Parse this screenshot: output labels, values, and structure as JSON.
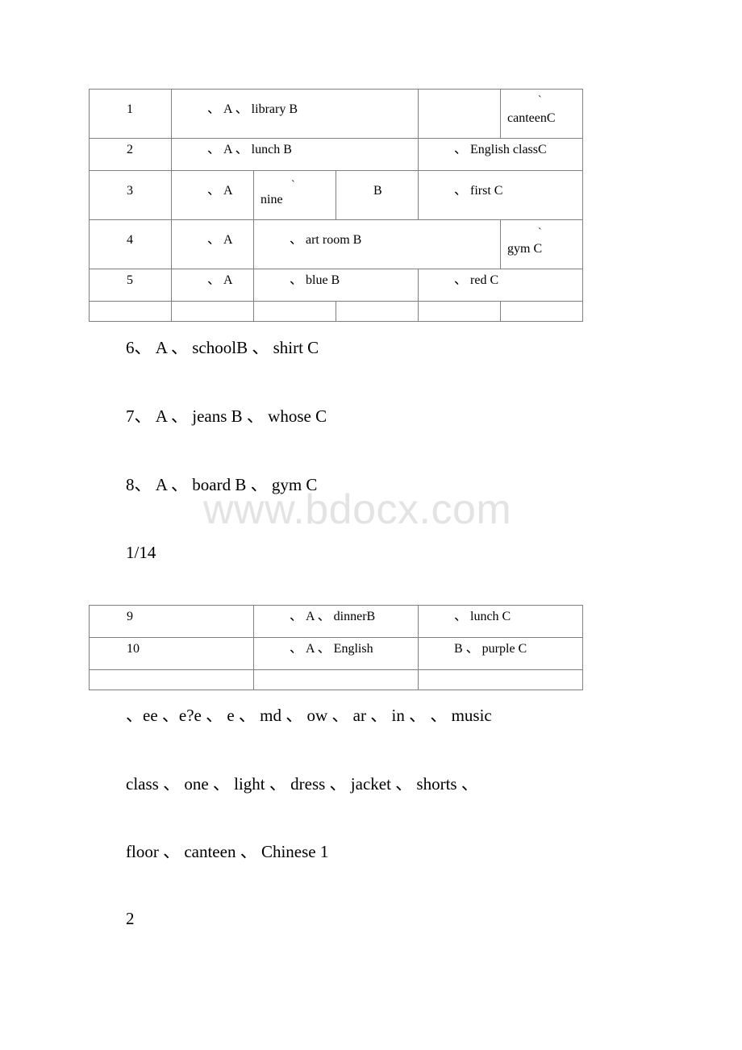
{
  "table1": {
    "rows": [
      {
        "num": "1",
        "a": "、 A 、 library B",
        "b": "",
        "c_mark": "`",
        "c": "canteenC"
      },
      {
        "num": "2",
        "a": "、 A 、 lunch B",
        "b": "、 English classC"
      },
      {
        "num": "3",
        "a": "、 A",
        "b_mark": "`",
        "b": "nine",
        "b2": "B",
        "c": "、 first C"
      },
      {
        "num": "4",
        "a": "、 A",
        "b": "、 art room B",
        "c_mark": "`",
        "c": "gym C"
      },
      {
        "num": "5",
        "a": "、 A",
        "b": "、 blue B",
        "c": "、 red C"
      }
    ]
  },
  "questions": [
    "6、 A 、 schoolB 、 shirt C",
    "7、 A 、 jeans B 、 whose C",
    "8、 A 、 board B 、 gym C"
  ],
  "watermark": "www.bdocx.com",
  "page_number": "1/14",
  "table2": {
    "rows": [
      {
        "num": "9",
        "a": "、 A 、 dinnerB",
        "b": "、 lunch C"
      },
      {
        "num": "10",
        "a": "、 A 、 English",
        "b": "B 、 purple C"
      }
    ]
  },
  "word_lines": [
    "、ee 、e?e 、 e 、 md 、 ow 、 ar 、 in 、 、 music",
    "class 、 one 、 light 、 dress 、 jacket 、 shorts 、",
    "floor 、 canteen 、 Chinese 1",
    "2"
  ]
}
